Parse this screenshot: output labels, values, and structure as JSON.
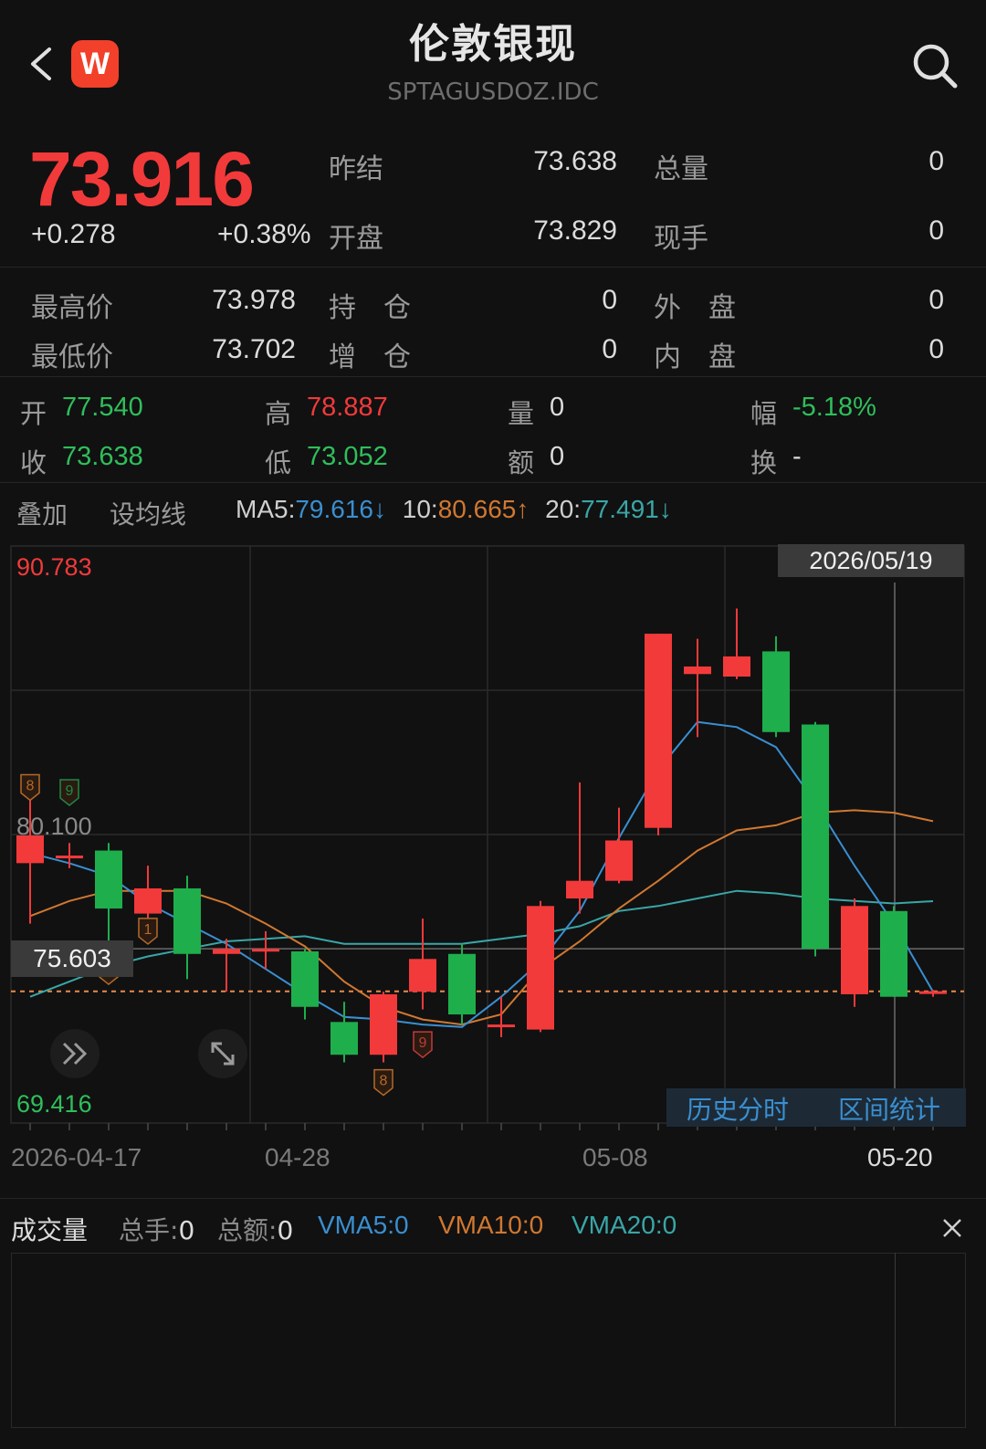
{
  "header": {
    "title": "伦敦银现",
    "code": "SPTAGUSDOZ.IDC",
    "badge": "W"
  },
  "quote": {
    "price": "73.916",
    "change": "+0.278",
    "change_pct": "+0.38%",
    "stats_right": [
      {
        "label": "昨结",
        "value": "73.638",
        "label2": "总量",
        "value2": "0"
      },
      {
        "label": "开盘",
        "value": "73.829",
        "label2": "现手",
        "value2": "0"
      }
    ],
    "stats_lower": [
      {
        "label": "最高价",
        "value": "73.978",
        "label2": "持　仓",
        "value2": "0",
        "label3": "外　盘",
        "value3": "0"
      },
      {
        "label": "最低价",
        "value": "73.702",
        "label2": "增　仓",
        "value2": "0",
        "label3": "内　盘",
        "value3": "0"
      }
    ]
  },
  "period_stats": {
    "open_label": "开",
    "open": "77.540",
    "high_label": "高",
    "high": "78.887",
    "vol_label": "量",
    "vol": "0",
    "amp_label": "幅",
    "amp": "-5.18%",
    "close_label": "收",
    "close": "73.638",
    "low_label": "低",
    "low": "73.052",
    "amount_label": "额",
    "amount": "0",
    "turn_label": "换",
    "turn": "-"
  },
  "toolbar": {
    "overlay": "叠加",
    "set_ma": "设均线",
    "ma5_label": "MA5:",
    "ma5": "79.616↓",
    "ma10_label": "10:",
    "ma10": "80.665↑",
    "ma20_label": "20:",
    "ma20": "77.491↓"
  },
  "colors": {
    "up": "#f23a3a",
    "down": "#1fae4c",
    "ma5": "#3a8fd0",
    "ma10": "#d07830",
    "ma20": "#3aa6a6"
  },
  "chart_data": {
    "type": "candlestick",
    "ylim": [
      69.416,
      90.783
    ],
    "y_top_label": "90.783",
    "y_mid_label": "80.100",
    "y_bottom_label": "69.416",
    "crosshair_value": "75.603",
    "crosshair_date": "2026/05/19",
    "last_price_line": 73.916,
    "x_labels": [
      "2026-04-17",
      "04-28",
      "05-08",
      "05-20"
    ],
    "candles": [
      {
        "o": 79.0,
        "h": 81.5,
        "l": 76.6,
        "c": 80.1
      },
      {
        "o": 79.3,
        "h": 79.8,
        "l": 78.8,
        "c": 79.3
      },
      {
        "o": 79.5,
        "h": 79.8,
        "l": 75.9,
        "c": 77.2
      },
      {
        "o": 77.0,
        "h": 78.9,
        "l": 76.2,
        "c": 78.0
      },
      {
        "o": 78.0,
        "h": 78.5,
        "l": 74.4,
        "c": 75.4
      },
      {
        "o": 75.4,
        "h": 76.0,
        "l": 73.9,
        "c": 75.6
      },
      {
        "o": 75.6,
        "h": 76.3,
        "l": 74.8,
        "c": 75.6
      },
      {
        "o": 75.5,
        "h": 75.6,
        "l": 72.8,
        "c": 73.3
      },
      {
        "o": 72.7,
        "h": 73.5,
        "l": 71.1,
        "c": 71.4
      },
      {
        "o": 71.4,
        "h": 73.9,
        "l": 71.1,
        "c": 73.8
      },
      {
        "o": 73.9,
        "h": 76.8,
        "l": 73.2,
        "c": 75.2
      },
      {
        "o": 75.4,
        "h": 75.8,
        "l": 72.6,
        "c": 73.0
      },
      {
        "o": 72.5,
        "h": 73.7,
        "l": 72.1,
        "c": 72.6
      },
      {
        "o": 72.4,
        "h": 77.5,
        "l": 72.3,
        "c": 77.3
      },
      {
        "o": 77.6,
        "h": 82.2,
        "l": 77.0,
        "c": 78.3
      },
      {
        "o": 78.3,
        "h": 81.2,
        "l": 78.2,
        "c": 79.9
      },
      {
        "o": 80.4,
        "h": 88.1,
        "l": 80.1,
        "c": 88.1
      },
      {
        "o": 86.5,
        "h": 87.9,
        "l": 84.0,
        "c": 86.8
      },
      {
        "o": 86.4,
        "h": 89.1,
        "l": 86.3,
        "c": 87.2
      },
      {
        "o": 87.4,
        "h": 88.0,
        "l": 84.0,
        "c": 84.2
      },
      {
        "o": 84.5,
        "h": 84.6,
        "l": 75.3,
        "c": 75.6
      },
      {
        "o": 73.8,
        "h": 77.6,
        "l": 73.3,
        "c": 77.3
      },
      {
        "o": 77.1,
        "h": 77.3,
        "l": 73.7,
        "c": 73.7
      },
      {
        "o": 73.9,
        "h": 73.97,
        "l": 73.7,
        "c": 73.92
      }
    ],
    "ma5": [
      79.4,
      79.0,
      78.5,
      77.4,
      76.6,
      75.8,
      74.8,
      73.8,
      72.9,
      72.8,
      72.6,
      72.5,
      73.7,
      75.1,
      77.1,
      80.0,
      82.7,
      84.6,
      84.4,
      83.6,
      81.4,
      78.9,
      76.6,
      73.9
    ],
    "ma10": [
      76.9,
      77.5,
      77.9,
      77.9,
      77.9,
      77.4,
      76.6,
      75.7,
      74.3,
      73.3,
      72.8,
      72.6,
      73.0,
      74.8,
      75.9,
      77.2,
      78.3,
      79.5,
      80.3,
      80.5,
      81.0,
      81.1,
      81.0,
      80.665
    ],
    "ma20": [
      73.7,
      74.3,
      74.9,
      75.3,
      75.6,
      75.9,
      76.0,
      76.1,
      75.8,
      75.8,
      75.8,
      75.8,
      76.0,
      76.2,
      76.5,
      77.1,
      77.3,
      77.6,
      77.9,
      77.8,
      77.6,
      77.5,
      77.4,
      77.491
    ]
  },
  "chart_actions": {
    "history": "历史分时",
    "range_stats": "区间统计"
  },
  "volume": {
    "title": "成交量",
    "total_hands_label": "总手:",
    "total_hands": "0",
    "total_amount_label": "总额:",
    "total_amount": "0",
    "vma5_label": "VMA5:",
    "vma5": "0",
    "vma10_label": "VMA10:",
    "vma10": "0",
    "vma20_label": "VMA20:",
    "vma20": "0"
  },
  "markers": [
    "8",
    "9",
    "1",
    "2",
    "8",
    "9"
  ]
}
